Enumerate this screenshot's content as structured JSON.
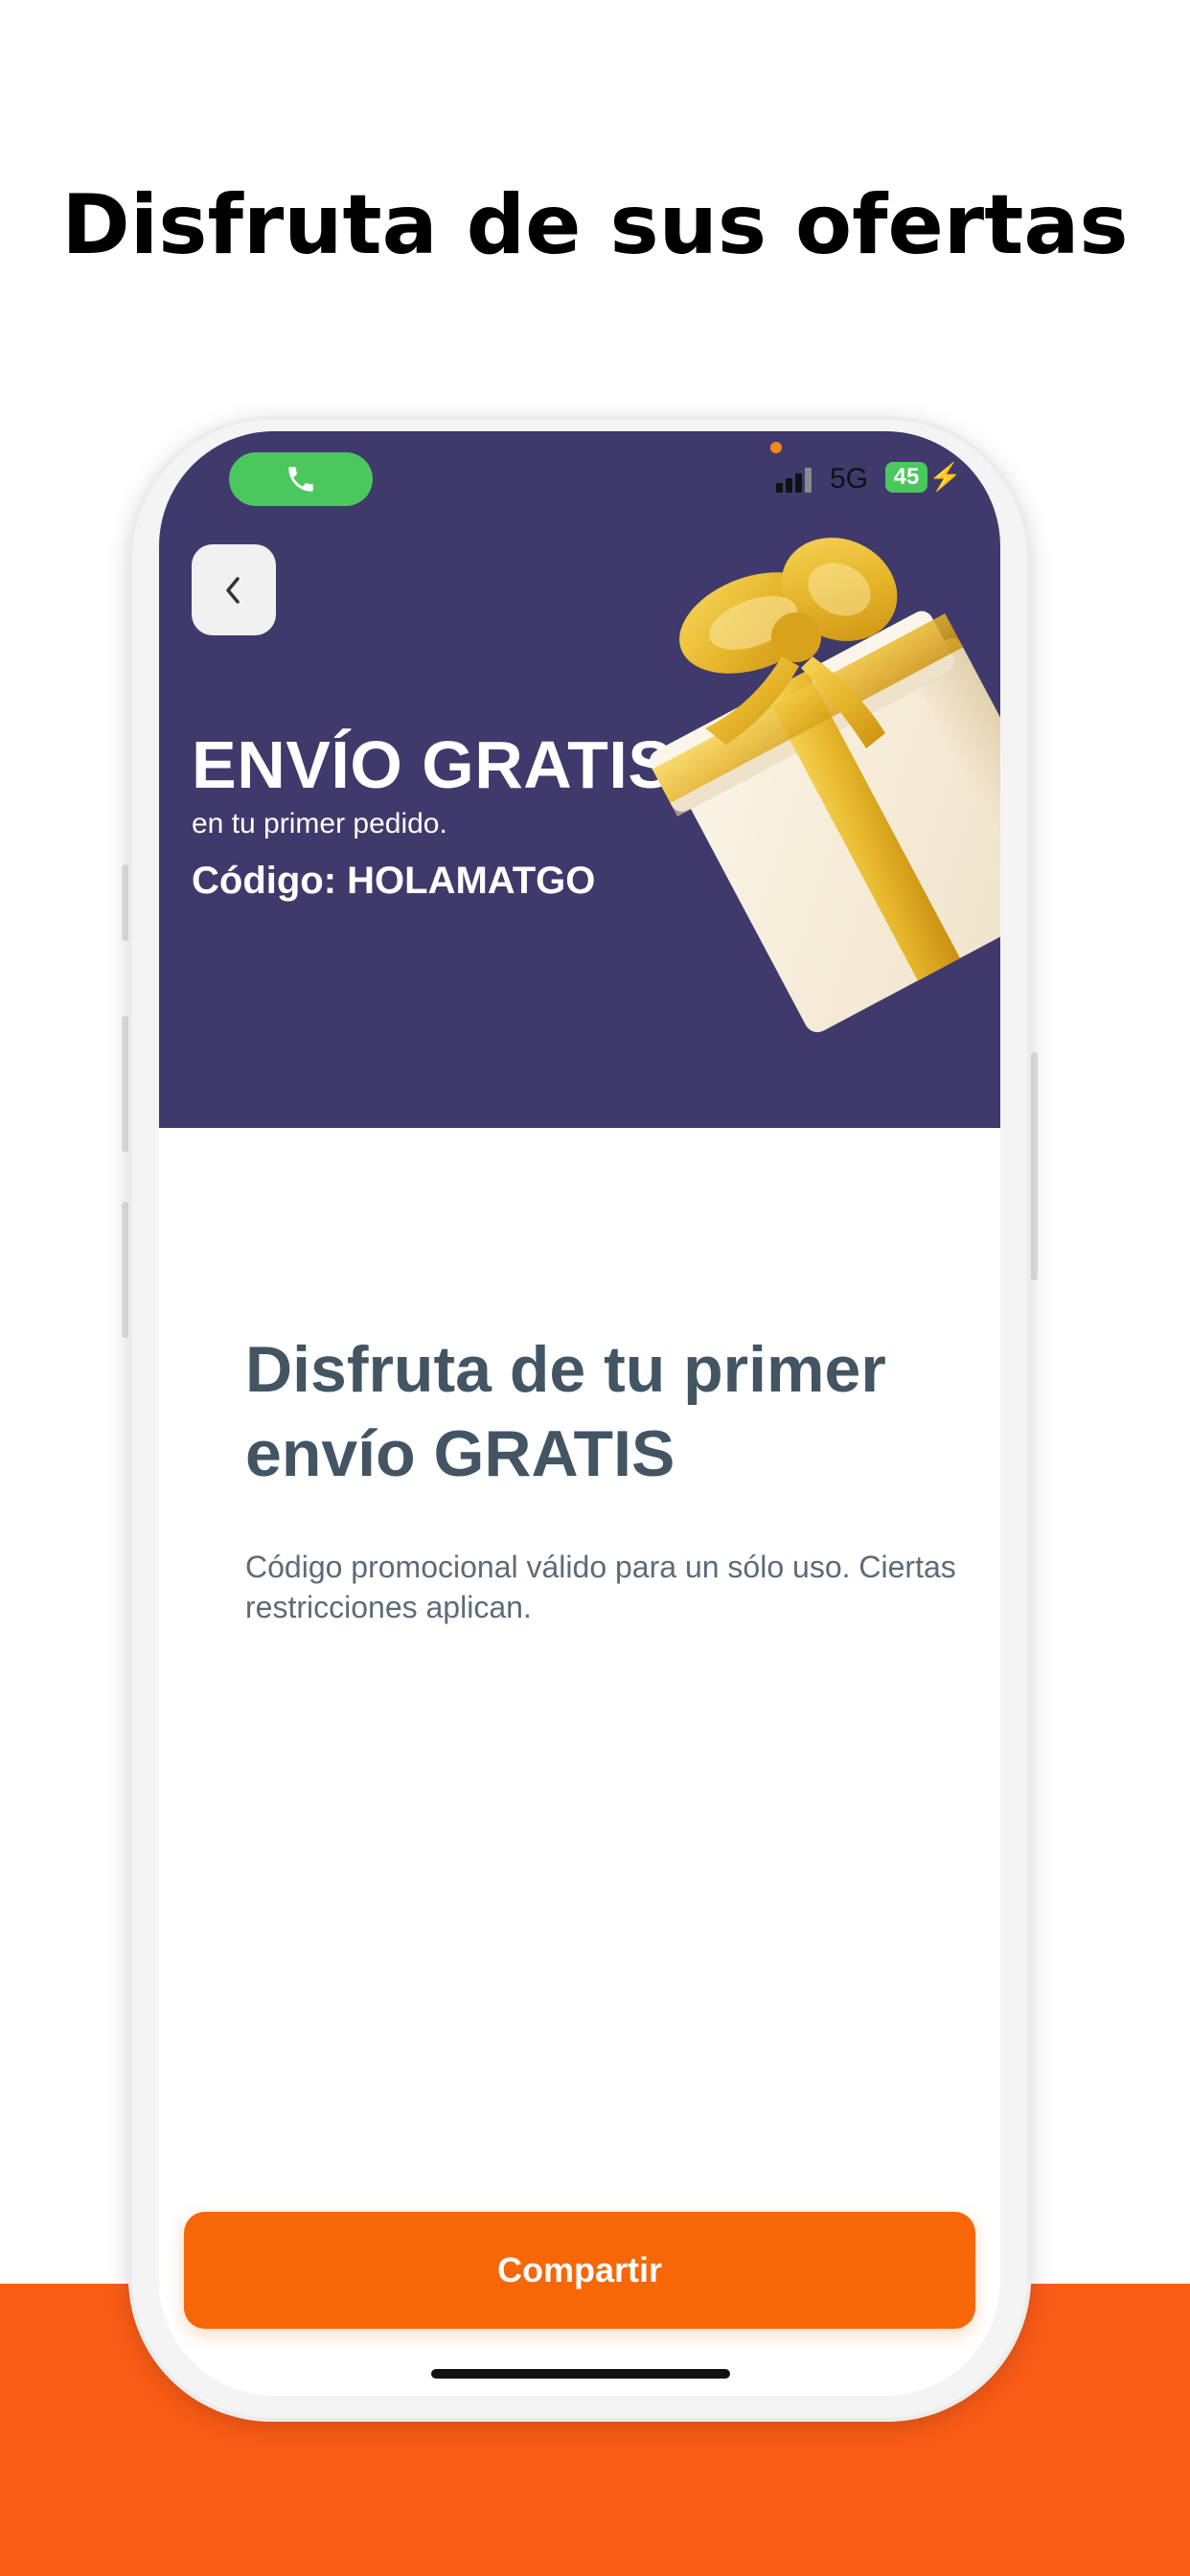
{
  "headline": "Disfruta de sus ofertas",
  "status_bar": {
    "network": "5G",
    "battery": "45",
    "call_icon": "phone-icon",
    "signal_icon": "signal-bars-icon",
    "charging_icon": "bolt-icon"
  },
  "banner": {
    "title": "ENVÍO GRATIS",
    "subtitle": "en tu primer pedido.",
    "code": "Código: HOLAMATGO",
    "background_color": "#3f3a6b",
    "back_icon": "chevron-left-icon",
    "illustration": "gift-box-illustration"
  },
  "content": {
    "title": "Disfruta de tu primer envío GRATIS",
    "description": "Código promocional válido para un sólo uso. Ciertas restricciones aplican."
  },
  "share_button": {
    "label": "Compartir",
    "color": "#f76707"
  },
  "colors": {
    "accent_orange": "#f95c16",
    "banner_purple": "#3f3a6b",
    "text_slate": "#435563"
  }
}
